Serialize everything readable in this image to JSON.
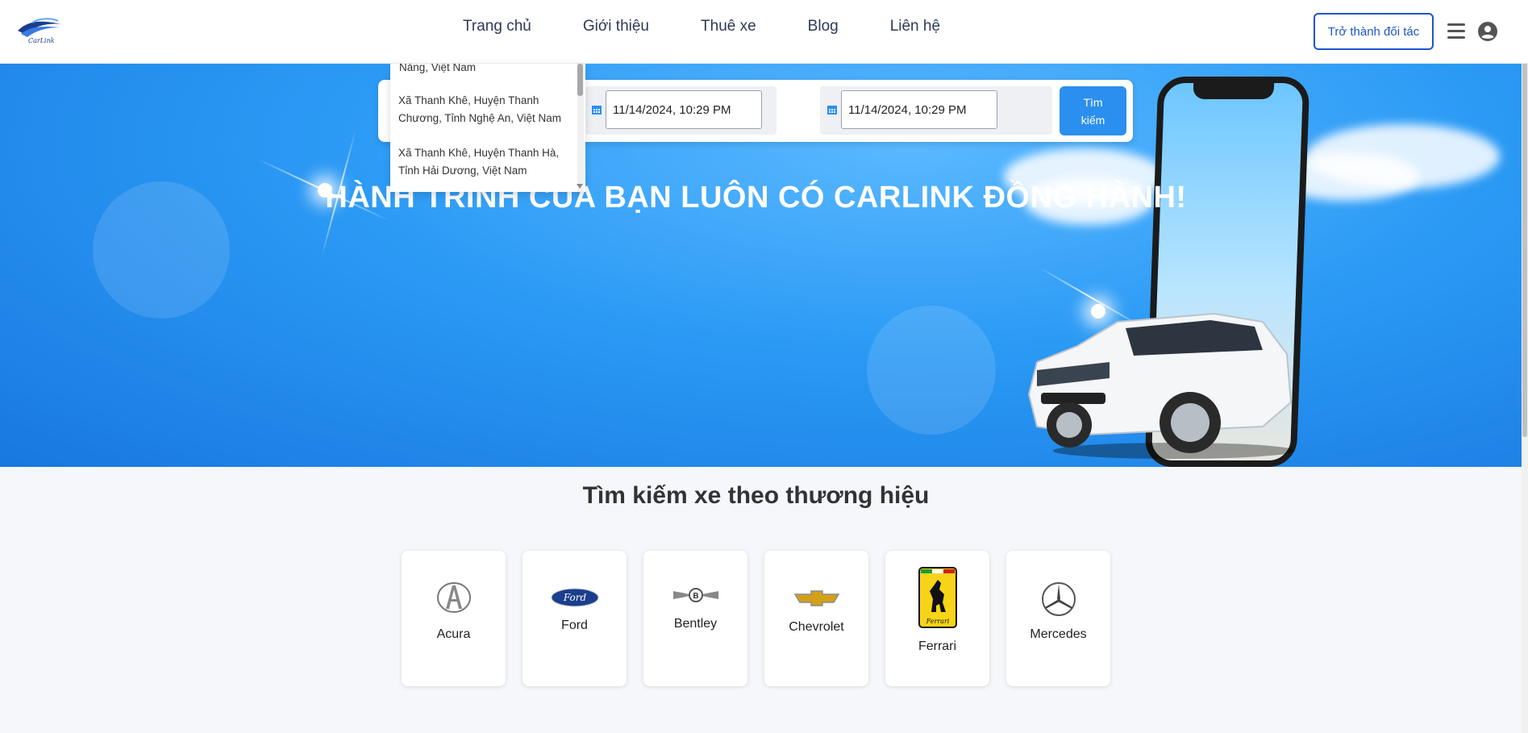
{
  "header": {
    "logo_text": "CarLink",
    "nav": [
      "Trang chủ",
      "Giới thiệu",
      "Thuê xe",
      "Blog",
      "Liên hệ"
    ],
    "partner_button": "Trở thành đối tác"
  },
  "hero": {
    "title": "HÀNH TRÌNH CỦA BẠN LUÔN CÓ CARLINK ĐỒNG HÀNH!"
  },
  "search": {
    "start_datetime": "11/14/2024, 10:29 PM",
    "end_datetime": "11/14/2024, 10:29 PM",
    "button_line1": "Tìm",
    "button_line2": "kiếm"
  },
  "dropdown": {
    "items": [
      "Nẵng, Việt Nam",
      "Xã Thanh Khê, Huyện Thanh Chương, Tỉnh Nghệ An, Việt Nam",
      "Xã Thanh Khê, Huyện Thanh Hà, Tỉnh Hải Dương, Việt Nam"
    ]
  },
  "brands": {
    "title": "Tìm kiếm xe theo thương hiệu",
    "items": [
      "Acura",
      "Ford",
      "Bentley",
      "Chevrolet",
      "Ferrari",
      "Mercedes"
    ]
  },
  "colors": {
    "primary": "#2b8fef",
    "partner": "#1e56c8",
    "hero_bg": "#2b9af5"
  }
}
